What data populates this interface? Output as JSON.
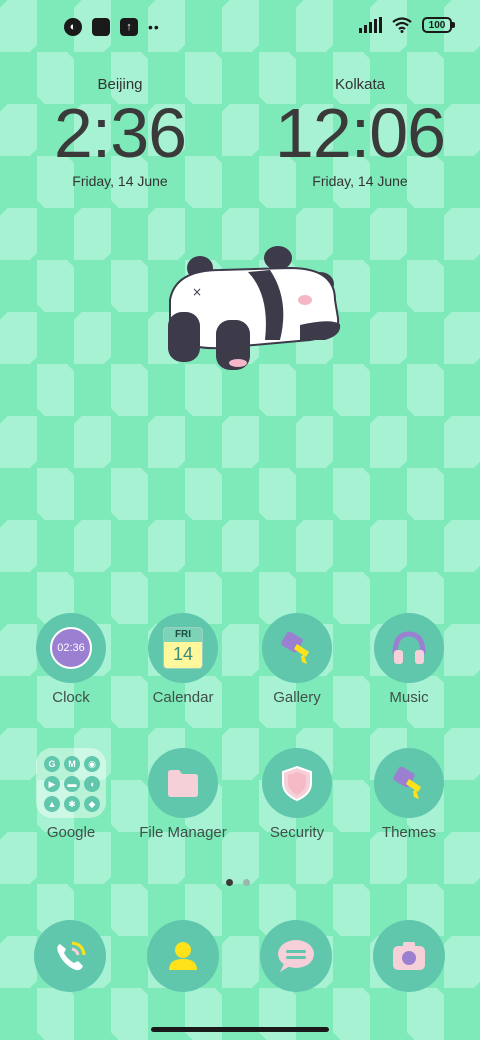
{
  "status_bar": {
    "battery": "100"
  },
  "clocks": [
    {
      "city": "Beijing",
      "time": "2:36",
      "date": "Friday, 14 June"
    },
    {
      "city": "Kolkata",
      "time": "12:06",
      "date": "Friday, 14 June"
    }
  ],
  "apps": {
    "clock": {
      "label": "Clock",
      "icon_text": "02:36"
    },
    "calendar": {
      "label": "Calendar",
      "day": "FRI",
      "date": "14"
    },
    "gallery": {
      "label": "Gallery"
    },
    "music": {
      "label": "Music"
    },
    "google": {
      "label": "Google",
      "icons": [
        "G",
        "M",
        "",
        "",
        "",
        "",
        "",
        "",
        ""
      ]
    },
    "file_manager": {
      "label": "File Manager"
    },
    "security": {
      "label": "Security"
    },
    "themes": {
      "label": "Themes"
    }
  },
  "dock": [
    "phone-icon",
    "contacts-icon",
    "messages-icon",
    "camera-icon"
  ],
  "colors": {
    "icon_bg": "#60c7ad",
    "accent_purple": "#9b7fd1",
    "accent_yellow": "#ffe21a",
    "accent_pink": "#f6d0d8"
  }
}
